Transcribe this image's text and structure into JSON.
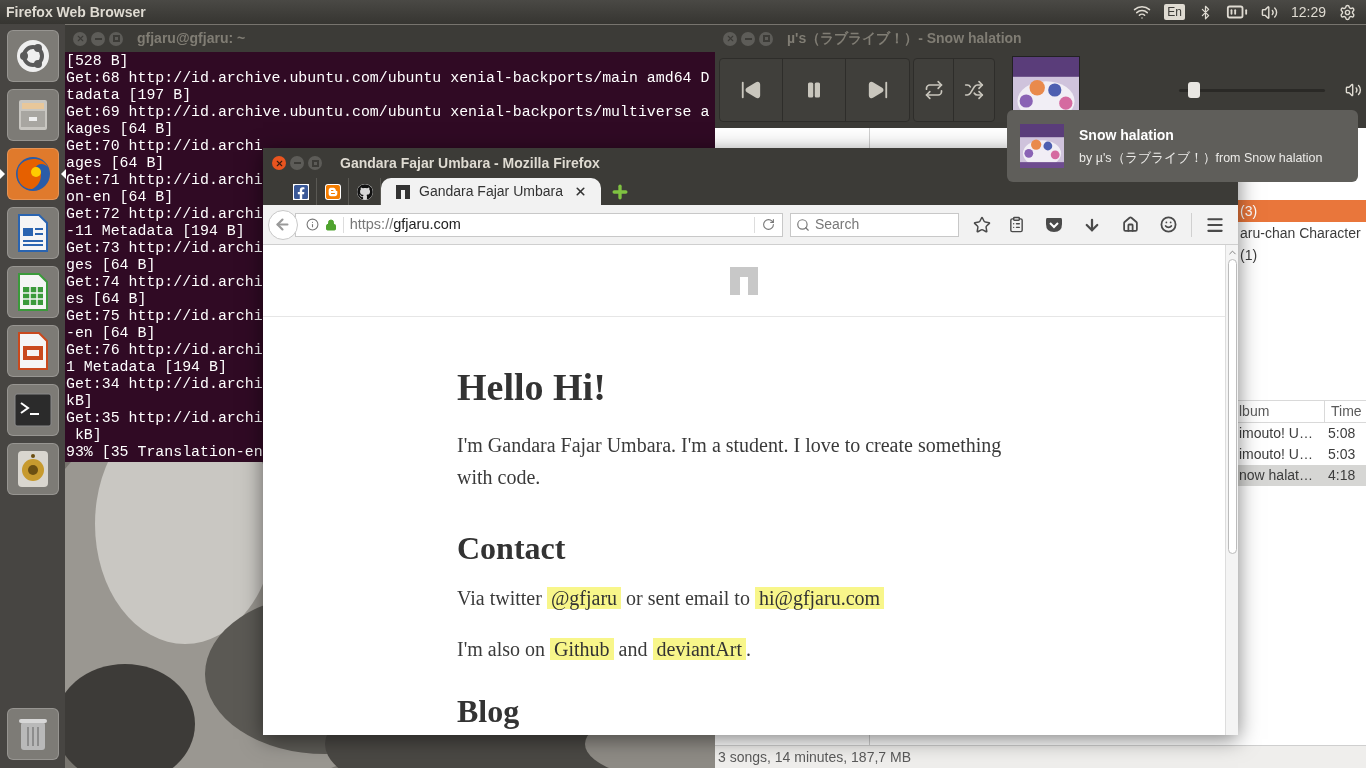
{
  "top_bar": {
    "title": "Firefox Web Browser",
    "keyboard": "En",
    "clock": "12:29"
  },
  "launcher": [
    {
      "selected": false
    },
    {
      "selected": false
    },
    {
      "selected": true
    },
    {
      "selected": false
    },
    {
      "selected": false
    },
    {
      "selected": false
    },
    {
      "selected": false
    },
    {
      "selected": false
    },
    {
      "selected": false
    }
  ],
  "terminal": {
    "title": "gfjaru@gfjaru: ~",
    "lines": [
      "[528 B]",
      "Get:68 http://id.archive.ubuntu.com/ubuntu xenial-backports/main amd64 D",
      "tadata [197 B]",
      "Get:69 http://id.archive.ubuntu.com/ubuntu xenial-backports/multiverse a",
      "kages [64 B]",
      "Get:70 http://id.archi",
      "ages [64 B]",
      "Get:71 http://id.archi",
      "on-en [64 B]",
      "Get:72 http://id.archi",
      "-11 Metadata [194 B]",
      "Get:73 http://id.archi",
      "ges [64 B]",
      "Get:74 http://id.archi",
      "es [64 B]",
      "Get:75 http://id.archi",
      "-en [64 B]",
      "Get:76 http://id.archi",
      "1 Metadata [194 B]",
      "Get:34 http://id.archi",
      "kB]",
      "Get:35 http://id.archi",
      " kB]",
      "93% [35 Translation-en"
    ]
  },
  "player": {
    "title": "µ's（ラブライブ！）- Snow halation",
    "playing": true,
    "volume": {
      "level": 0.06
    },
    "browser_rows": [
      {
        "text": "(3)",
        "selected": true
      },
      {
        "text": "aru-chan Character",
        "selected": false
      },
      {
        "text": "(1)",
        "selected": false
      }
    ],
    "columns": [
      "lbum",
      "Time"
    ],
    "tracks": [
      {
        "album": "imouto! U…",
        "time": "5:08",
        "selected": false
      },
      {
        "album": "imouto! U…",
        "time": "5:03",
        "selected": false
      },
      {
        "album": "now halat…",
        "time": "4:18",
        "selected": true
      }
    ],
    "status": "3 songs, 14 minutes, 187,7 MB"
  },
  "notification": {
    "title": "Snow halation",
    "body": "by µ's（ラブライブ！）from Snow halation"
  },
  "firefox": {
    "title": "Gandara Fajar Umbara - Mozilla Firefox",
    "tabs": [
      {
        "kind": "facebook",
        "selected": false
      },
      {
        "kind": "blogger",
        "selected": false
      },
      {
        "kind": "github",
        "selected": false
      },
      {
        "kind": "page",
        "label": "Gandara Fajar Umbara",
        "selected": true
      }
    ],
    "url": {
      "scheme": "https://",
      "host": "gfjaru.com"
    },
    "search_placeholder": "Search",
    "page": {
      "heading": "Hello Hi!",
      "intro": "I'm Gandara Fajar Umbara. I'm a student. I love to create something with code.",
      "sections": [
        {
          "heading": "Contact",
          "paragraphs": [
            [
              {
                "kind": "text",
                "text": "Via twitter "
              },
              {
                "kind": "link",
                "text": "@gfjaru"
              },
              {
                "kind": "text",
                "text": " or sent email to "
              },
              {
                "kind": "link",
                "text": "hi@gfjaru.com"
              }
            ],
            [
              {
                "kind": "text",
                "text": "I'm also on "
              },
              {
                "kind": "link",
                "text": "Github"
              },
              {
                "kind": "text",
                "text": " and "
              },
              {
                "kind": "link",
                "text": "deviantArt"
              },
              {
                "kind": "text",
                "text": "."
              }
            ]
          ]
        },
        {
          "heading": "Blog"
        }
      ]
    }
  }
}
